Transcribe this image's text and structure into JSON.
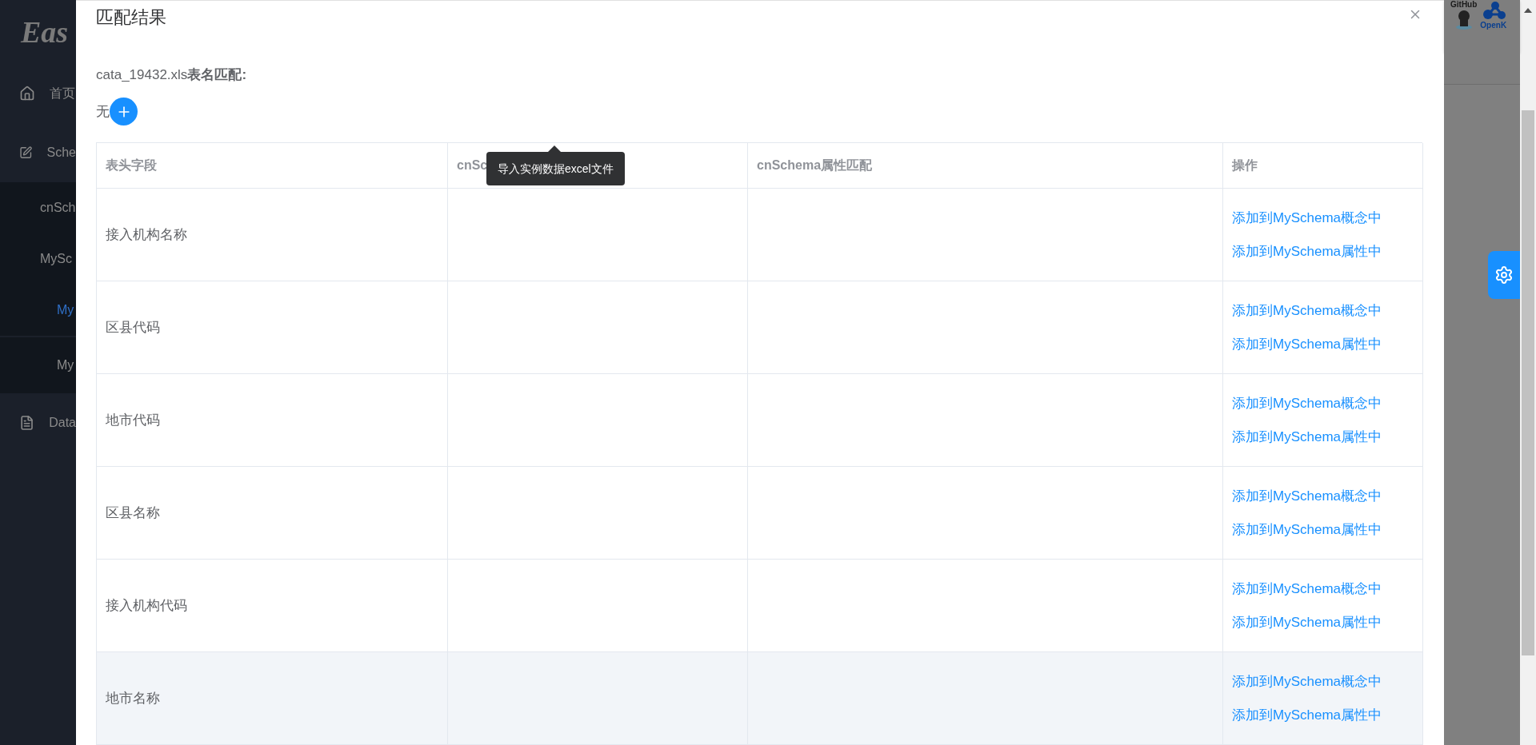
{
  "sidebar": {
    "logo": "Eas",
    "items": [
      {
        "label": "首页",
        "kind": "top",
        "selected": false
      },
      {
        "label": "Sche",
        "kind": "top",
        "selected": false
      },
      {
        "label": "cnSch",
        "kind": "sub",
        "selected": false
      },
      {
        "label": "MySc",
        "kind": "sub",
        "selected": false
      },
      {
        "label": "My",
        "kind": "subsub",
        "selected": true
      },
      {
        "label": "My",
        "kind": "sub2",
        "selected": false
      },
      {
        "label": "Data",
        "kind": "top",
        "selected": false
      }
    ]
  },
  "header_links": [
    {
      "label": "GitHub",
      "kind": "github"
    },
    {
      "label": "OpenK",
      "kind": "openk"
    }
  ],
  "dialog": {
    "title": "匹配结果",
    "file_line": "cata_19432.xls**表名匹配:**",
    "table_match": "无",
    "tooltip": "导入实例数据excel文件",
    "table": {
      "columns": [
        "表头字段",
        "cnSc",
        "cnSchema属性匹配",
        "操作"
      ],
      "rows": [
        {
          "field": "接入机构名称",
          "actions": [
            "添加到MySchema概念中",
            "添加到MySchema属性中"
          ],
          "hovered": false
        },
        {
          "field": "区县代码",
          "actions": [
            "添加到MySchema概念中",
            "添加到MySchema属性中"
          ],
          "hovered": false
        },
        {
          "field": "地市代码",
          "actions": [
            "添加到MySchema概念中",
            "添加到MySchema属性中"
          ],
          "hovered": false
        },
        {
          "field": "区县名称",
          "actions": [
            "添加到MySchema概念中",
            "添加到MySchema属性中"
          ],
          "hovered": false
        },
        {
          "field": "接入机构代码",
          "actions": [
            "添加到MySchema概念中",
            "添加到MySchema属性中"
          ],
          "hovered": false
        },
        {
          "field": "地市名称",
          "actions": [
            "添加到MySchema概念中",
            "添加到MySchema属性中"
          ],
          "hovered": true
        }
      ]
    }
  }
}
